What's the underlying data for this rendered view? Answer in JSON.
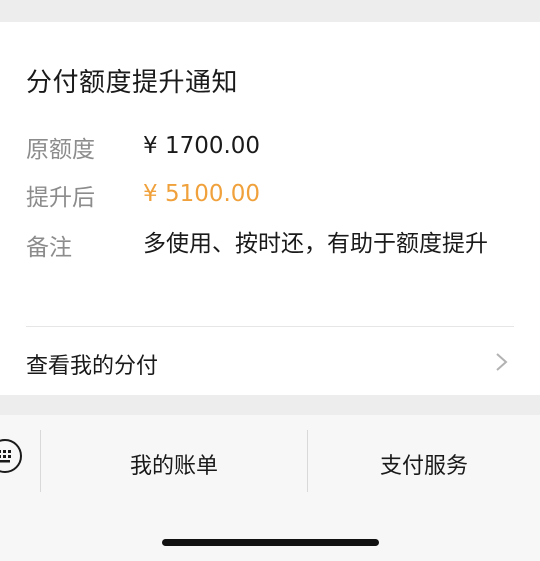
{
  "card": {
    "title": "分付额度提升通知",
    "rows": [
      {
        "label": "原额度",
        "value": "¥ 1700.00"
      },
      {
        "label": "提升后",
        "value": "¥ 5100.00"
      },
      {
        "label": "备注",
        "value": "多使用、按时还，有助于额度提升"
      }
    ],
    "link_label": "查看我的分付"
  },
  "bottom_menu": {
    "items": [
      "我的账单",
      "支付服务"
    ]
  },
  "colors": {
    "accent": "#f0a13b",
    "label_gray": "#8c8c8c",
    "background": "#ededed"
  },
  "icons": {
    "keyboard": "keyboard-icon",
    "chevron": "chevron-right-icon"
  }
}
